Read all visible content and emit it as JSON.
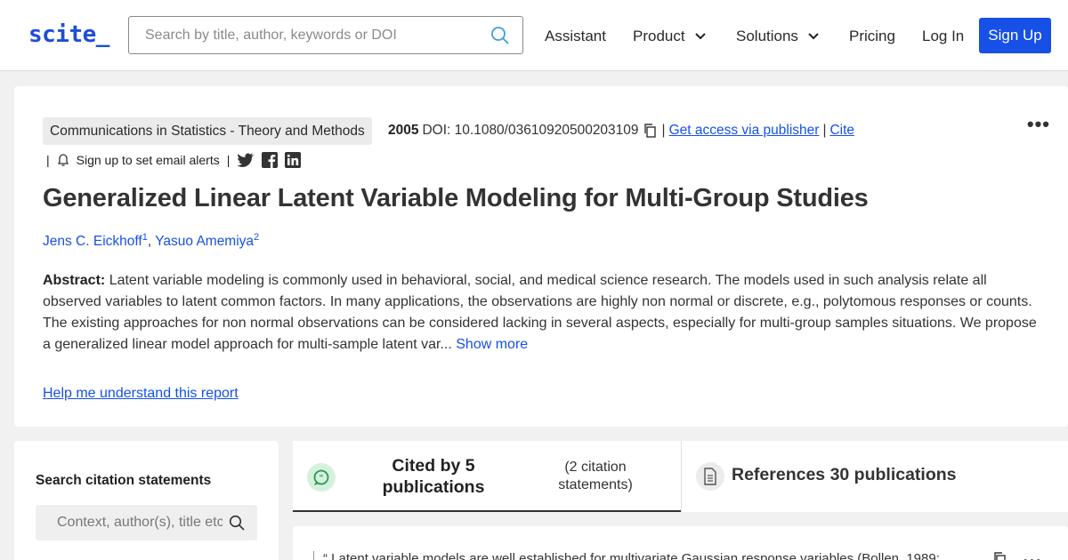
{
  "header": {
    "logo": "scite_",
    "search_placeholder": "Search by title, author, keywords or DOI",
    "nav": [
      "Assistant",
      "Product",
      "Solutions",
      "Pricing",
      "Log In"
    ],
    "signup": "Sign Up",
    "brand_color": "#1650e6"
  },
  "paper": {
    "journal": "Communications in Statistics - Theory and Methods",
    "year": "2005",
    "doi": "DOI: 10.1080/03610920500203109",
    "access_link": "Get access via publisher",
    "cite_link": "Cite",
    "alert_text": "Sign up to set email alerts",
    "title": "Generalized Linear Latent Variable Modeling for Multi-Group Studies",
    "authors": [
      {
        "name": "Jens C. Eickhoff",
        "sup": "1"
      },
      {
        "name": "Yasuo Amemiya",
        "sup": "2"
      }
    ],
    "abstract_label": "Abstract:",
    "abstract": "Latent variable modeling is commonly used in behavioral, social, and medical science research. The models used in such analysis relate all observed variables to latent common factors. In many applications, the observations are highly non normal or discrete, e.g., polytomous responses or counts. The existing approaches for non normal observations can be considered lacking in several aspects, especially for multi-group samples situations. We propose a generalized linear model approach for multi-sample latent var...",
    "show_more": "Show more",
    "help_link": "Help me understand this report"
  },
  "citations": {
    "search_heading": "Search citation statements",
    "search_placeholder": "Context, author(s), title etc.",
    "cited_tab": "Cited by 5 publications",
    "cited_sub": "(2 citation statements)",
    "refs_tab": "References 30 publications",
    "snippet": "Latent variable models are well established for multivariate Gaussian response variables (Bollen, 1989;"
  }
}
